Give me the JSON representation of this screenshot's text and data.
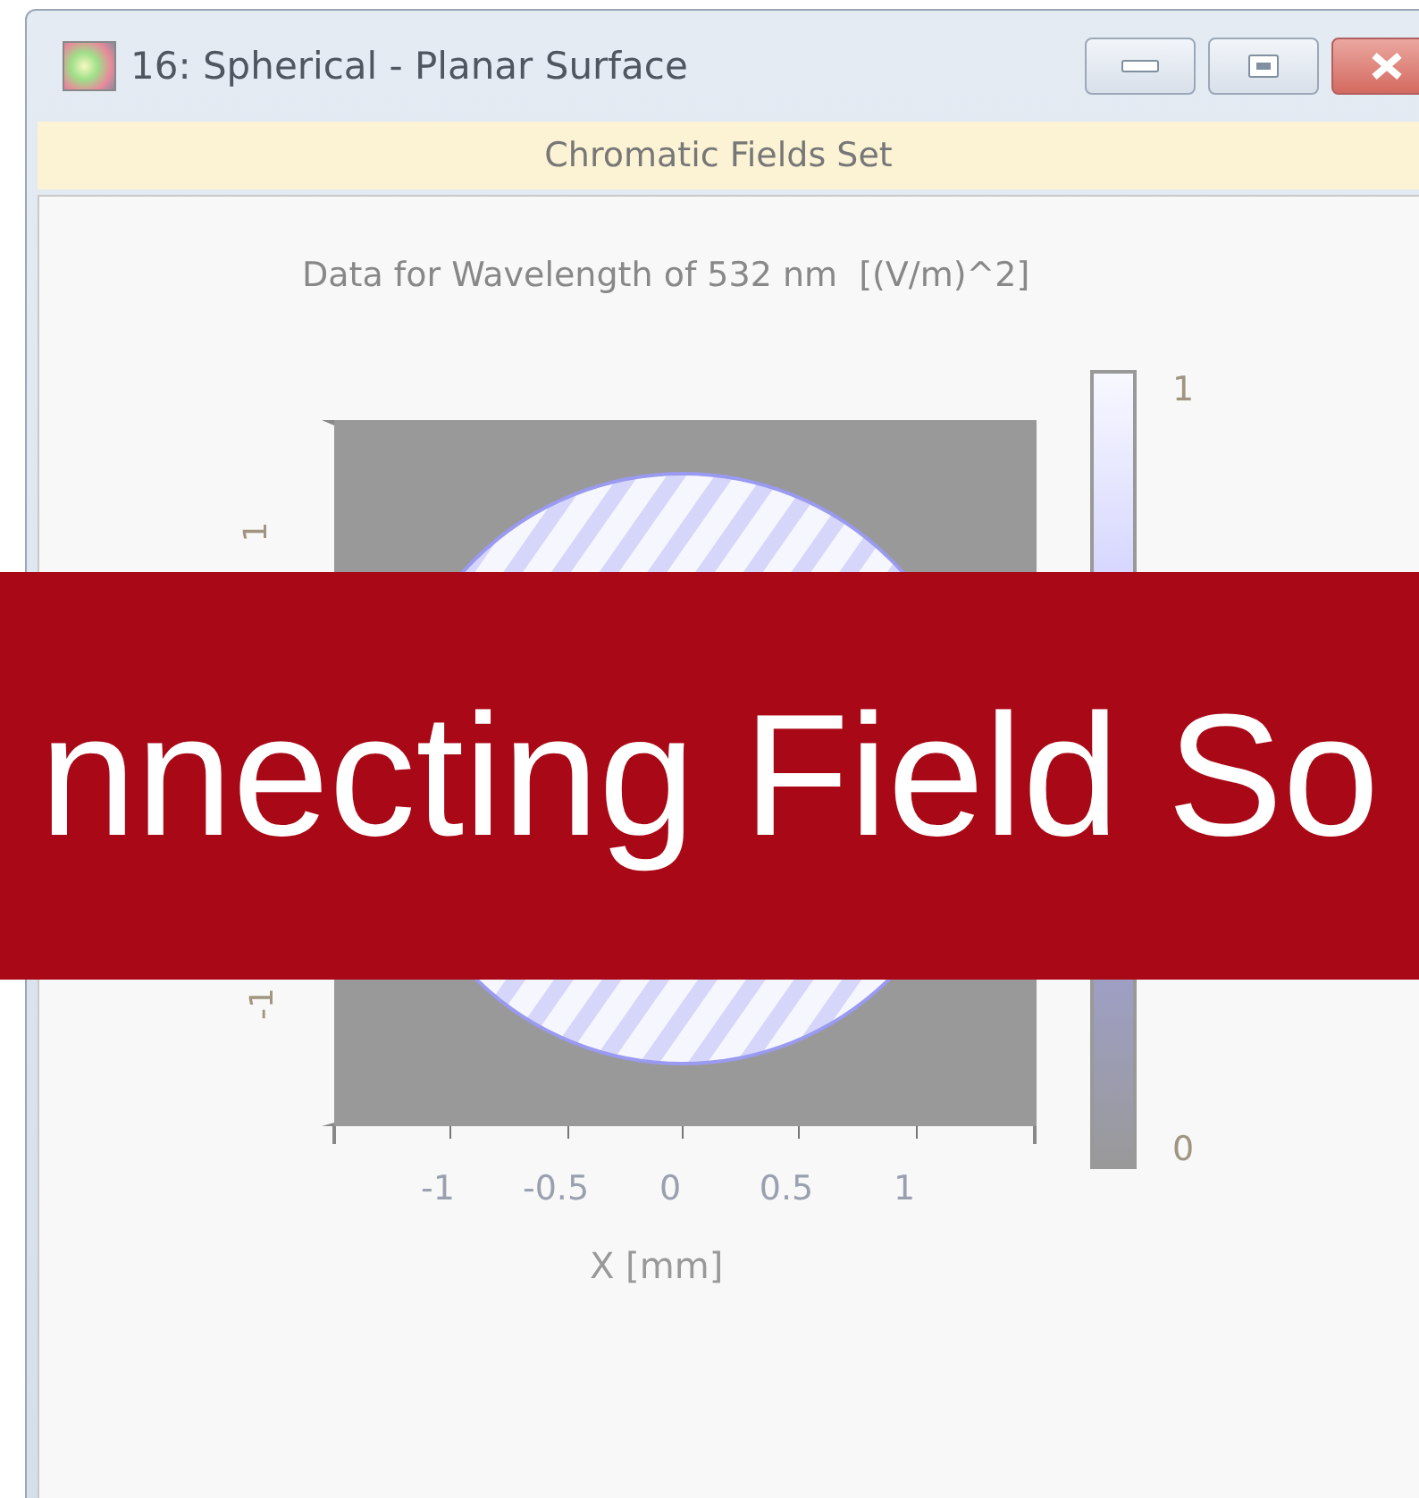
{
  "window": {
    "title": "16: Spherical - Planar Surface"
  },
  "header": "Chromatic Fields Set",
  "plot": {
    "title": "Data for Wavelength of 532 nm  [(V/m)^2]",
    "x_ticks": [
      "-1",
      "-0.5",
      "0",
      "0.5",
      "1"
    ],
    "y_ticks": [
      "1",
      "-1"
    ],
    "xlabel": "X [mm]",
    "colorbar": {
      "max_label": "1",
      "min_label": "0"
    }
  },
  "banner": "nnecting Field So"
}
